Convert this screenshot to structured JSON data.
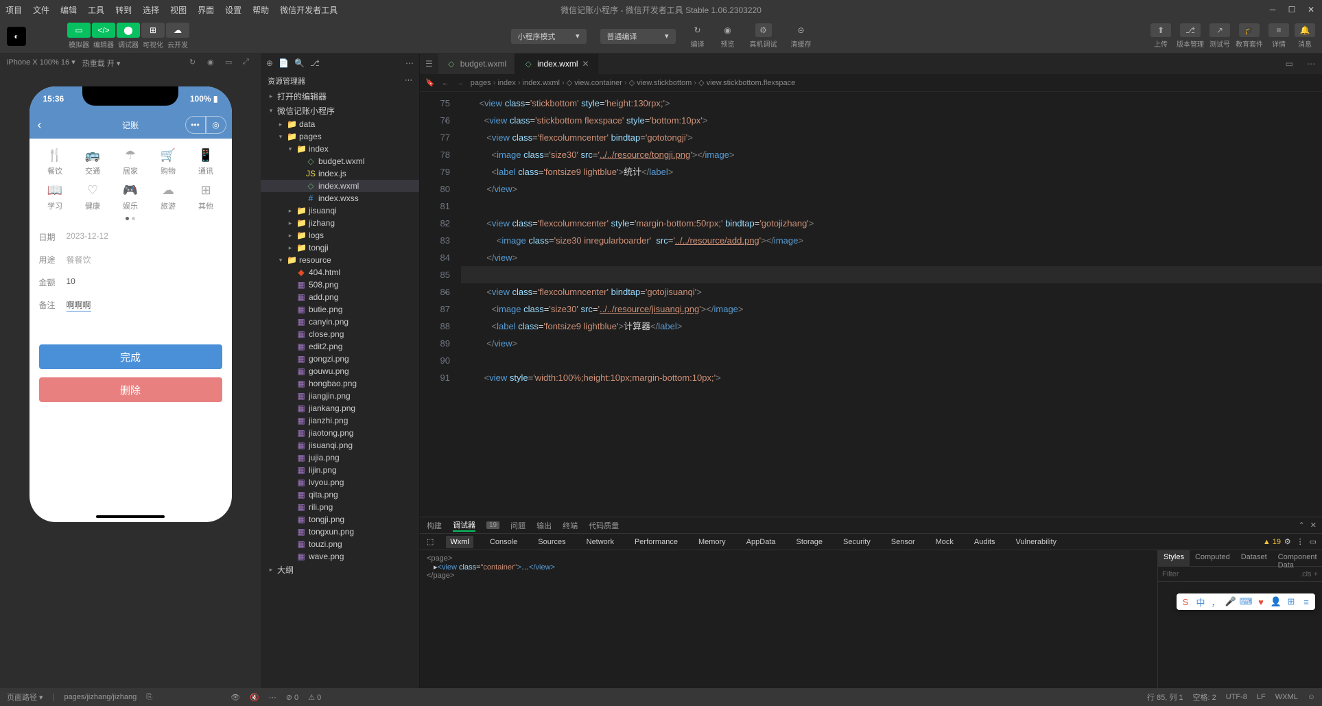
{
  "window": {
    "title": "微信记账小程序 - 微信开发者工具 Stable 1.06.2303220"
  },
  "menu": [
    "项目",
    "文件",
    "编辑",
    "工具",
    "转到",
    "选择",
    "视图",
    "界面",
    "设置",
    "帮助",
    "微信开发者工具"
  ],
  "toolbar": {
    "modes": [
      {
        "label": "模拟器"
      },
      {
        "label": "编辑器"
      },
      {
        "label": "调试器"
      },
      {
        "label": "可视化"
      },
      {
        "label": "云开发"
      }
    ],
    "dropdown1": "小程序模式",
    "dropdown2": "普通编译",
    "center_icons": [
      {
        "label": "编译"
      },
      {
        "label": "预览"
      },
      {
        "label": "真机调试"
      },
      {
        "label": "清缓存"
      }
    ],
    "right_icons": [
      {
        "label": "上传"
      },
      {
        "label": "版本管理"
      },
      {
        "label": "测试号"
      },
      {
        "label": "教育套件"
      },
      {
        "label": "详情"
      },
      {
        "label": "消息"
      }
    ]
  },
  "simulator": {
    "device": "iPhone X 100% 16",
    "hot_reload": "热重载 开",
    "time": "15:36",
    "battery": "100%",
    "page_title": "记账",
    "categories": [
      {
        "name": "餐饮"
      },
      {
        "name": "交通"
      },
      {
        "name": "居家"
      },
      {
        "name": "购物"
      },
      {
        "name": "通讯"
      },
      {
        "name": "学习"
      },
      {
        "name": "健康"
      },
      {
        "name": "娱乐"
      },
      {
        "name": "旅游"
      },
      {
        "name": "其他"
      }
    ],
    "form": {
      "date_label": "日期",
      "date_value": "2023-12-12",
      "purpose_label": "用途",
      "purpose_value": "餐餐饮",
      "amount_label": "金额",
      "amount_value": "10",
      "remark_label": "备注",
      "remark_value": "啊啊啊"
    },
    "btn_done": "完成",
    "btn_delete": "删除"
  },
  "explorer": {
    "title": "资源管理器",
    "sections": {
      "open_editors": "打开的编辑器",
      "project": "微信记账小程序",
      "outline": "大纲"
    },
    "tree": [
      {
        "name": "data",
        "type": "folder",
        "indent": 1
      },
      {
        "name": "pages",
        "type": "folder",
        "indent": 1,
        "open": true
      },
      {
        "name": "index",
        "type": "folder",
        "indent": 2,
        "open": true
      },
      {
        "name": "budget.wxml",
        "type": "wxml",
        "indent": 3
      },
      {
        "name": "index.js",
        "type": "js",
        "indent": 3
      },
      {
        "name": "index.wxml",
        "type": "wxml",
        "indent": 3,
        "selected": true
      },
      {
        "name": "index.wxss",
        "type": "wxss",
        "indent": 3
      },
      {
        "name": "jisuanqi",
        "type": "folder",
        "indent": 2
      },
      {
        "name": "jizhang",
        "type": "folder",
        "indent": 2
      },
      {
        "name": "logs",
        "type": "folder",
        "indent": 2
      },
      {
        "name": "tongji",
        "type": "folder",
        "indent": 2
      },
      {
        "name": "resource",
        "type": "folder",
        "indent": 1,
        "open": true
      },
      {
        "name": "404.html",
        "type": "html",
        "indent": 2
      },
      {
        "name": "508.png",
        "type": "img",
        "indent": 2
      },
      {
        "name": "add.png",
        "type": "img",
        "indent": 2
      },
      {
        "name": "butie.png",
        "type": "img",
        "indent": 2
      },
      {
        "name": "canyin.png",
        "type": "img",
        "indent": 2
      },
      {
        "name": "close.png",
        "type": "img",
        "indent": 2
      },
      {
        "name": "edit2.png",
        "type": "img",
        "indent": 2
      },
      {
        "name": "gongzi.png",
        "type": "img",
        "indent": 2
      },
      {
        "name": "gouwu.png",
        "type": "img",
        "indent": 2
      },
      {
        "name": "hongbao.png",
        "type": "img",
        "indent": 2
      },
      {
        "name": "jiangjin.png",
        "type": "img",
        "indent": 2
      },
      {
        "name": "jiankang.png",
        "type": "img",
        "indent": 2
      },
      {
        "name": "jianzhi.png",
        "type": "img",
        "indent": 2
      },
      {
        "name": "jiaotong.png",
        "type": "img",
        "indent": 2
      },
      {
        "name": "jisuanqi.png",
        "type": "img",
        "indent": 2
      },
      {
        "name": "jujia.png",
        "type": "img",
        "indent": 2
      },
      {
        "name": "lijin.png",
        "type": "img",
        "indent": 2
      },
      {
        "name": "lvyou.png",
        "type": "img",
        "indent": 2
      },
      {
        "name": "qita.png",
        "type": "img",
        "indent": 2
      },
      {
        "name": "rili.png",
        "type": "img",
        "indent": 2
      },
      {
        "name": "tongji.png",
        "type": "img",
        "indent": 2
      },
      {
        "name": "tongxun.png",
        "type": "img",
        "indent": 2
      },
      {
        "name": "touzi.png",
        "type": "img",
        "indent": 2
      },
      {
        "name": "wave.png",
        "type": "img",
        "indent": 2
      }
    ]
  },
  "tabs": [
    {
      "name": "budget.wxml",
      "icon": "wxml"
    },
    {
      "name": "index.wxml",
      "icon": "wxml",
      "active": true
    }
  ],
  "breadcrumb": [
    "pages",
    "index",
    "index.wxml",
    "view.container",
    "view.stickbottom",
    "view.stickbottom.flexspace"
  ],
  "code_start_line": 75,
  "devtools": {
    "top_tabs": [
      "构建",
      "调试器",
      "19",
      "问题",
      "输出",
      "终端",
      "代码质量"
    ],
    "top_active": "调试器",
    "sub_tabs": [
      "Wxml",
      "Console",
      "Sources",
      "Network",
      "Performance",
      "Memory",
      "AppData",
      "Storage",
      "Security",
      "Sensor",
      "Mock",
      "Audits",
      "Vulnerability"
    ],
    "sub_active": "Wxml",
    "warnings": "19",
    "dom_lines": [
      "<page>",
      "▸<view class=\"container\">…</view>",
      "</page>"
    ],
    "styles_tabs": [
      "Styles",
      "Computed",
      "Dataset",
      "Component Data"
    ],
    "filter_placeholder": "Filter",
    "cls": ".cls"
  },
  "statusbar": {
    "left": [
      "页面路径 ▾",
      "pages/jizhang/jizhang"
    ],
    "errors": "0",
    "warns": "0",
    "right": [
      "行 85, 列 1",
      "空格: 2",
      "UTF-8",
      "LF",
      "WXML"
    ]
  }
}
